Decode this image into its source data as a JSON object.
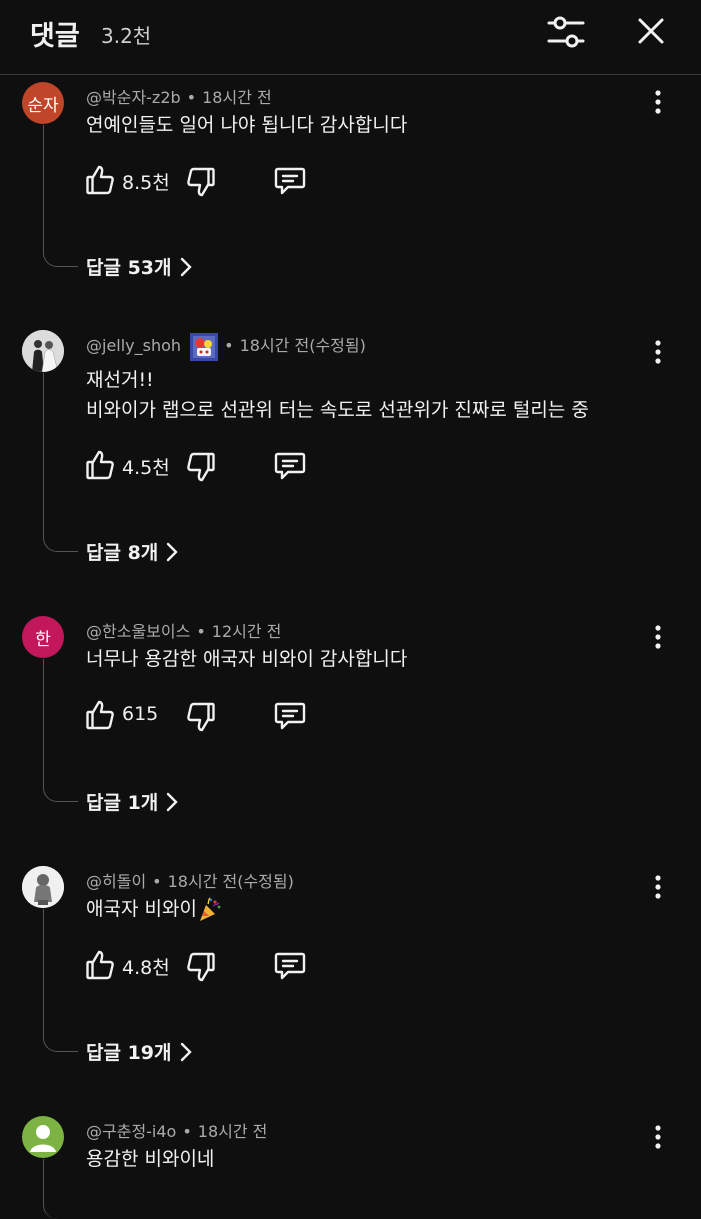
{
  "header": {
    "title": "댓글",
    "count": "3.2천"
  },
  "comments": [
    {
      "author": "@박순자-z2b",
      "time": "18시간 전",
      "avatar_text": "순자",
      "avatar_color": "#c0462a",
      "lines": [
        "연예인들도 일어 나야 됩니다  감사합니다"
      ],
      "likes": "8.5천",
      "replies": "답글 53개"
    },
    {
      "author": "@jelly_shoh",
      "time": "18시간 전(수정됨)",
      "avatar_text": "",
      "avatar_color": "#d8d8d8",
      "lines": [
        "재선거!!",
        "비와이가 랩으로 선관위  터는 속도로 선관위가 진짜로 털리는 중"
      ],
      "likes": "4.5천",
      "replies": "답글 8개"
    },
    {
      "author": "@한소울보이스",
      "time": "12시간 전",
      "avatar_text": "한",
      "avatar_color": "#c2185b",
      "lines": [
        "너무나 용감한 애국자 비와이 감사합니다"
      ],
      "likes": "615",
      "replies": "답글 1개"
    },
    {
      "author": "@히돌이",
      "time": "18시간 전(수정됨)",
      "avatar_text": "",
      "avatar_color": "#e8e8e8",
      "lines": [
        "애국자 비와이"
      ],
      "likes": "4.8천",
      "replies": "답글 19개"
    },
    {
      "author": "@구춘정-i4o",
      "time": "18시간 전",
      "avatar_text": "",
      "avatar_color": "#7cb342",
      "lines": [
        "용감한 비와이네"
      ]
    }
  ]
}
